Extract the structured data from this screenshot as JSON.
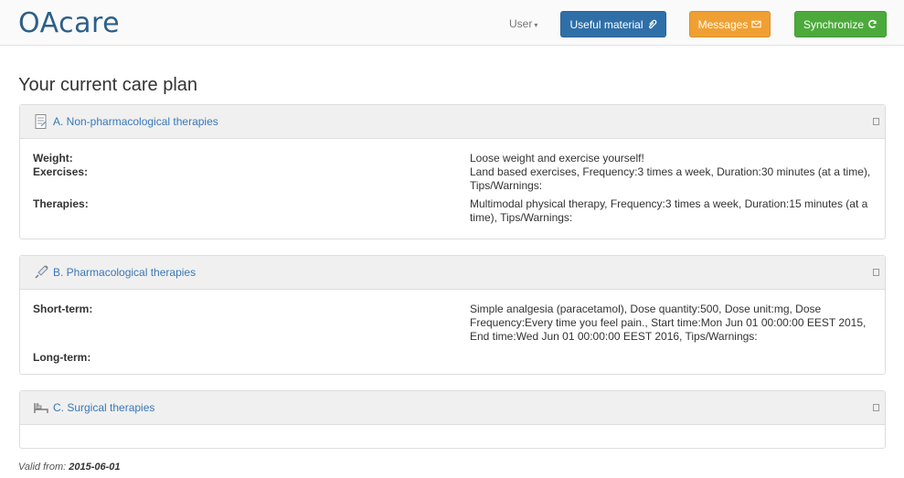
{
  "app": {
    "brand": "OAcare",
    "user_menu": "User",
    "buttons": {
      "useful_material": "Useful material",
      "messages": "Messages",
      "synchronize": "Synchronize"
    }
  },
  "page": {
    "title": "Your current care plan"
  },
  "panels": [
    {
      "title": "A. Non-pharmacological therapies",
      "icon": "document-icon",
      "rows": [
        {
          "label": "Weight:",
          "value": "Loose weight and exercise yourself!"
        },
        {
          "label": "Exercises:",
          "value": "Land based exercises, Frequency:3 times a week, Duration:30 minutes (at a time), Tips/Warnings:"
        },
        {
          "label": "Therapies:",
          "value": "Multimodal physical therapy, Frequency:3 times a week, Duration:15 minutes (at a time), Tips/Warnings:"
        }
      ]
    },
    {
      "title": "B. Pharmacological therapies",
      "icon": "syringe-icon",
      "rows": [
        {
          "label": "Short-term:",
          "value": "Simple analgesia (paracetamol), Dose quantity:500, Dose unit:mg, Dose Frequency:Every time you feel pain., Start time:Mon Jun 01 00:00:00 EEST 2015, End time:Wed Jun 01 00:00:00 EEST 2016, Tips/Warnings:"
        },
        {
          "label": "Long-term:",
          "value": ""
        }
      ]
    },
    {
      "title": "C. Surgical therapies",
      "icon": "hospital-bed-icon",
      "rows": []
    }
  ],
  "footer": {
    "valid_from_label": "Valid from:",
    "valid_from_date": "2015-06-01"
  },
  "colors": {
    "brand": "#2d5f8a",
    "useful": "#2f6fa8",
    "messages": "#f0a033",
    "sync": "#4caa3b",
    "panel_title": "#3a78b8"
  }
}
